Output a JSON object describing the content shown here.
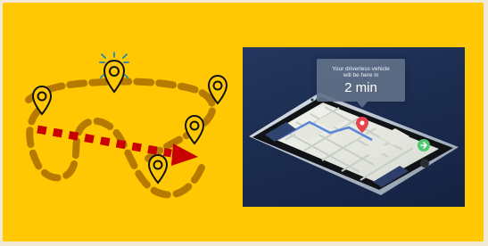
{
  "illustration": {
    "icons": [
      "location-pin-icon",
      "highlighted-location-pin-icon",
      "route-arrow-icon",
      "phone-map-icon"
    ]
  },
  "photo": {
    "callout": {
      "line1": "Your driverless vehicle",
      "line2": "will be here in",
      "time": "2 min"
    },
    "ui_colors": {
      "accent_red": "#e5434f",
      "accent_green": "#4fc870",
      "accent_blue": "#3d7ff0"
    }
  },
  "colors": {
    "background": "#ffc803",
    "route_brown": "#b77a00",
    "arrow_red": "#c70000",
    "teal_spark": "#3f8f8f"
  }
}
